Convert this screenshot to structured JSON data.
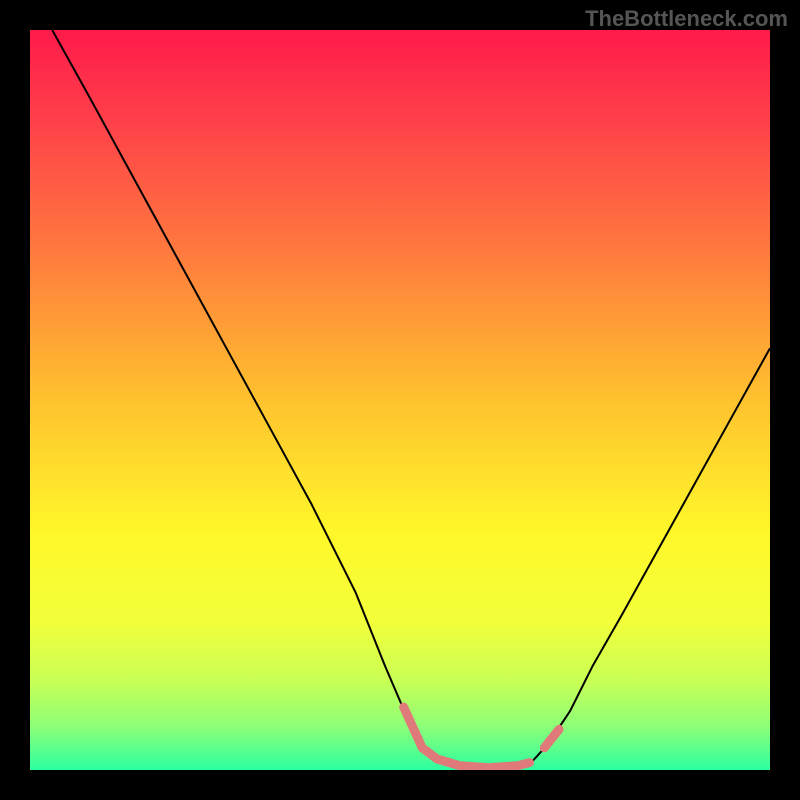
{
  "watermark": "TheBottleneck.com",
  "chart_data": {
    "type": "line",
    "title": "",
    "xlabel": "",
    "ylabel": "",
    "xlim": [
      0,
      100
    ],
    "ylim": [
      0,
      100
    ],
    "grid": false,
    "legend": false,
    "background_gradient": {
      "stops": [
        {
          "offset": 0.0,
          "color": "#ff1a4a"
        },
        {
          "offset": 0.12,
          "color": "#ff3f4a"
        },
        {
          "offset": 0.3,
          "color": "#ff7a3e"
        },
        {
          "offset": 0.5,
          "color": "#ffc22e"
        },
        {
          "offset": 0.68,
          "color": "#fff82a"
        },
        {
          "offset": 0.8,
          "color": "#f2ff3a"
        },
        {
          "offset": 0.88,
          "color": "#c8ff55"
        },
        {
          "offset": 0.94,
          "color": "#8eff77"
        },
        {
          "offset": 1.0,
          "color": "#2dffa0"
        }
      ]
    },
    "series": [
      {
        "name": "curve",
        "color": "#000000",
        "width": 2,
        "x": [
          3,
          8,
          14,
          20,
          26,
          32,
          38,
          44,
          48,
          51,
          53,
          55,
          58,
          62,
          66,
          68,
          70,
          73,
          76,
          80,
          85,
          90,
          95,
          100
        ],
        "y": [
          100,
          91,
          80,
          69,
          58,
          47,
          36,
          24,
          14,
          7,
          3,
          1.5,
          0.6,
          0.3,
          0.6,
          1.3,
          3.5,
          8,
          14,
          21,
          30,
          39,
          48,
          57
        ]
      },
      {
        "name": "highlight",
        "color": "#e07a7a",
        "width": 9,
        "linecap": "round",
        "segments": [
          {
            "x": [
              50.5,
              53,
              55,
              58,
              62,
              66,
              67.5
            ],
            "y": [
              8.5,
              3,
              1.5,
              0.6,
              0.3,
              0.6,
              1.0
            ]
          },
          {
            "x": [
              69.5,
              71.5
            ],
            "y": [
              3.0,
              5.5
            ]
          }
        ]
      }
    ]
  }
}
